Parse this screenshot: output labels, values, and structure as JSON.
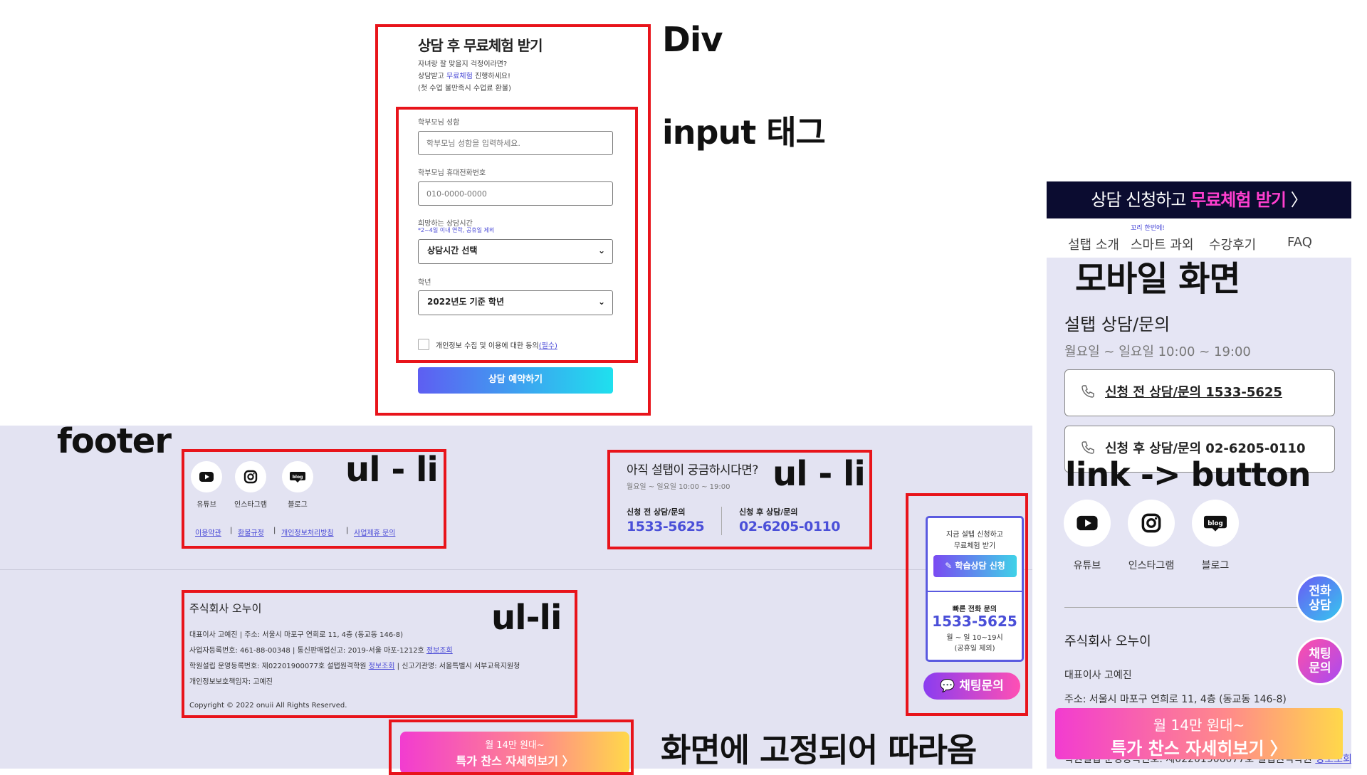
{
  "annotations": {
    "div": "Div",
    "input_tag": "input 태그",
    "footer": "footer",
    "ul_li_1": "ul - li",
    "ul_li_2": "ul - li",
    "ul_li_3": "ul-li",
    "link_button": "link -> button",
    "mobile_screen": "모바일 화면",
    "fixed_follow": "화면에 고정되어 따라옴"
  },
  "form": {
    "title": "상담 후 무료체험 받기",
    "desc_line1": "자녀랑 잘 맞을지 걱정이라면?",
    "desc_line2_pre": "상담받고 ",
    "desc_line2_link": "무료체험",
    "desc_line2_post": " 진행하세요!",
    "desc_line3": "(첫 수업 불만족시 수업료 환불)",
    "name_label": "학부모님 성함",
    "name_placeholder": "학부모님 성함을 입력하세요.",
    "phone_label": "학부모님 휴대전화번호",
    "phone_placeholder": "010-0000-0000",
    "time_label": "희망하는 상담시간",
    "time_note": "*2~4일 이내 연락, 공휴일 제외",
    "time_select": "상담시간 선택",
    "grade_label": "학년",
    "grade_select": "2022년도 기준 학년",
    "consent_text": "개인정보 수집 및 이용에 대한 동의",
    "consent_required": "(필수)",
    "submit_label": "상담 예약하기"
  },
  "footer": {
    "social": [
      {
        "label": "유튜브",
        "icon": "youtube-icon"
      },
      {
        "label": "인스타그램",
        "icon": "instagram-icon"
      },
      {
        "label": "블로그",
        "icon": "blog-icon"
      }
    ],
    "links": [
      "이용약관",
      "환불규정",
      "개인정보처리방침",
      "사업제휴 문의"
    ],
    "contact_title": "아직 설탭이 궁금하시다면?",
    "contact_hours": "월요일 ~ 일요일 10:00 ~ 19:00",
    "before_label": "신청 전 상담/문의",
    "before_phone": "1533-5625",
    "after_label": "신청 후 상담/문의",
    "after_phone": "02-6205-0110",
    "company": "주식회사 오누이",
    "info1": "대표이사 고예진 | 주소: 서울시 마포구 연희로 11, 4층 (동교동 146-8)",
    "info2_pre": "사업자등록번호: 461-88-00348 | 통신판매업신고: 2019-서울 마포-1212호 ",
    "info2_link": "정보조회",
    "info3_pre": "학원설립 운영등록번호: 제02201900077호 설탭원격학원 ",
    "info3_link": "정보조회",
    "info3_post": " | 신고기관명: 서울특별시 서부교육지원청",
    "info4": "개인정보보호책임자: 고예진",
    "copyright": "Copyright © 2022 onuii All Rights Reserved.",
    "promo_line1": "월 14만 원대~",
    "promo_line2": "특가 찬스 자세히보기 〉"
  },
  "side_widget": {
    "line1": "지금 설탭 신청하고",
    "line2": "무료체험 받기",
    "apply_button": "학습상담 신청",
    "quick_label": "빠른 전화 문의",
    "phone": "1533-5625",
    "hours": "월 ~ 일 10~19시",
    "holiday": "(공휴일 제외)",
    "chat_button": "채팅문의"
  },
  "mobile": {
    "banner_pre": "상담 신청하고 ",
    "banner_strong": "무료체험 받기",
    "banner_arrow": " 〉",
    "nav": [
      "설탭 소개",
      "스마트 과외",
      "수강후기",
      "FAQ"
    ],
    "nav_badge": "꼬리 한번에!",
    "consult_title": "설탭 상담/문의",
    "consult_hours": "월요일 ~ 일요일 10:00 ~ 19:00",
    "btn_before": "신청 전 상담/문의 1533-5625",
    "btn_after": "신청 후 상담/문의 02-6205-0110",
    "social": [
      "유튜브",
      "인스타그램",
      "블로그"
    ],
    "company": "주식회사 오누이",
    "ceo": "대표이사 고예진",
    "address": "주소: 서울시 마포구 연희로 11, 4층 (동교동 146-8)",
    "reg": "학원설립 운영등록번호: 제02201900077호 설탭원격학원 ",
    "reg_link": "정보조회",
    "bubble_phone": "전화\n상담",
    "bubble_chat": "채팅\n문의",
    "promo_line1": "월 14만 원대~",
    "promo_line2": "특가 찬스 자세히보기 〉"
  },
  "colors": {
    "annotation_red": "#e8141b",
    "brand_blue": "#4a4fd8",
    "footer_bg": "#e3e3f2",
    "banner_bg": "#0b0c30",
    "banner_accent": "#ff3fcf"
  }
}
